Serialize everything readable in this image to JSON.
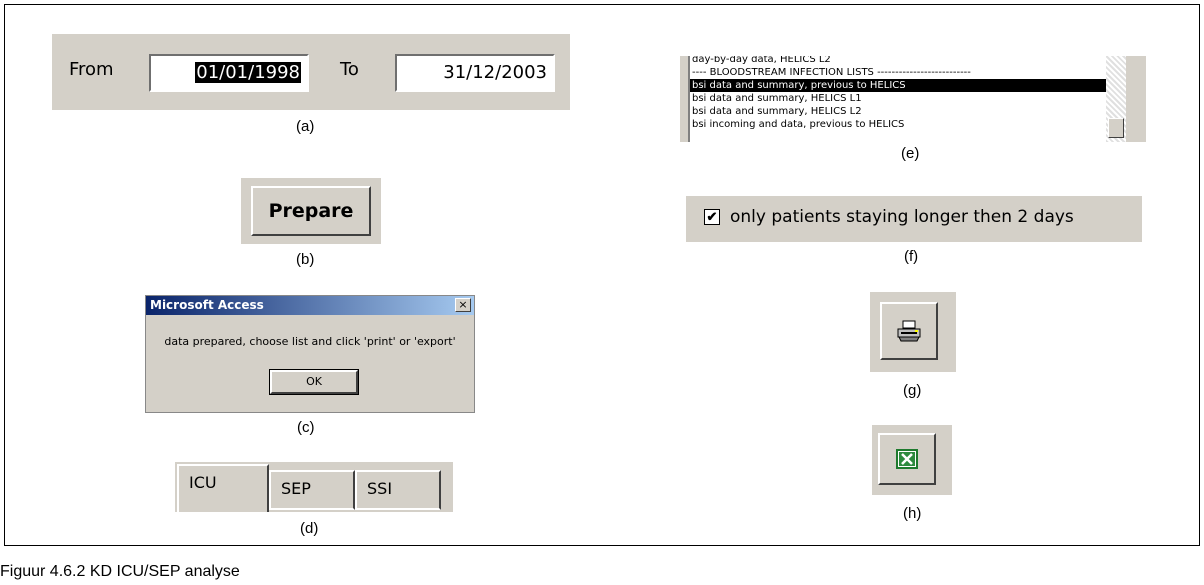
{
  "figure": {
    "caption": "Figuur 4.6.2 KD ICU/SEP analyse"
  },
  "panels": {
    "a": {
      "label": "(a)"
    },
    "b": {
      "label": "(b)"
    },
    "c": {
      "label": "(c)"
    },
    "d": {
      "label": "(d)"
    },
    "e": {
      "label": "(e)"
    },
    "f": {
      "label": "(f)"
    },
    "g": {
      "label": "(g)"
    },
    "h": {
      "label": "(h)"
    }
  },
  "date_range": {
    "from_label": "From",
    "from_value": "01/01/1998",
    "to_label": "To",
    "to_value": "31/12/2003"
  },
  "prepare_button": {
    "label": "Prepare"
  },
  "dialog": {
    "title": "Microsoft Access",
    "close_glyph": "×",
    "message": "data prepared, choose list and click 'print' or 'export'",
    "ok_label": "OK"
  },
  "tabs": [
    {
      "label": "ICU"
    },
    {
      "label": "SEP"
    },
    {
      "label": "SSI"
    }
  ],
  "list": {
    "items": [
      {
        "label": "day-by-day data, HELICS L2"
      },
      {
        "label": "---- BLOODSTREAM INFECTION LISTS --------------------------"
      },
      {
        "label": "bsi data and summary, previous to HELICS"
      },
      {
        "label": "bsi data and summary, HELICS L1"
      },
      {
        "label": "bsi data and summary, HELICS L2"
      },
      {
        "label": "bsi incoming and data, previous to HELICS"
      }
    ],
    "selected_index": 2
  },
  "checkbox": {
    "checked": true,
    "check_glyph": "✔",
    "label": "only patients staying longer then 2 days"
  },
  "icons": {
    "print": "printer-icon",
    "excel": "excel-icon"
  }
}
